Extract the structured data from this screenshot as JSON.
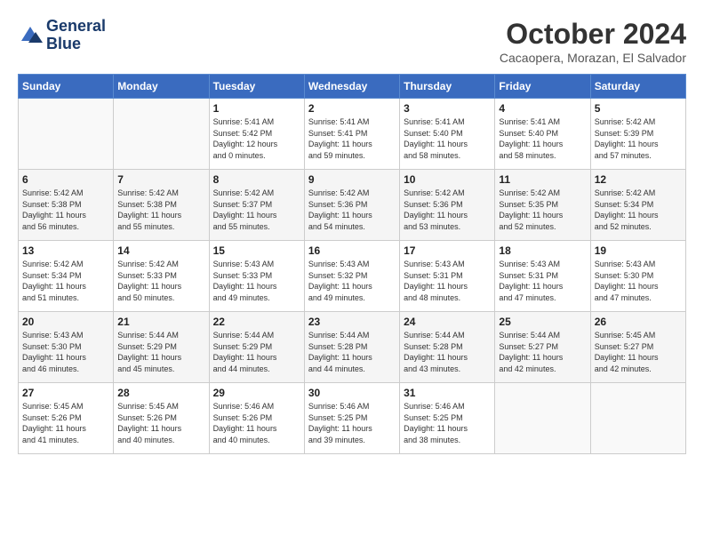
{
  "logo": {
    "text_line1": "General",
    "text_line2": "Blue"
  },
  "title": "October 2024",
  "location": "Cacaopera, Morazan, El Salvador",
  "days_of_week": [
    "Sunday",
    "Monday",
    "Tuesday",
    "Wednesday",
    "Thursday",
    "Friday",
    "Saturday"
  ],
  "weeks": [
    [
      {
        "day": "",
        "info": ""
      },
      {
        "day": "",
        "info": ""
      },
      {
        "day": "1",
        "info": "Sunrise: 5:41 AM\nSunset: 5:42 PM\nDaylight: 12 hours\nand 0 minutes."
      },
      {
        "day": "2",
        "info": "Sunrise: 5:41 AM\nSunset: 5:41 PM\nDaylight: 11 hours\nand 59 minutes."
      },
      {
        "day": "3",
        "info": "Sunrise: 5:41 AM\nSunset: 5:40 PM\nDaylight: 11 hours\nand 58 minutes."
      },
      {
        "day": "4",
        "info": "Sunrise: 5:41 AM\nSunset: 5:40 PM\nDaylight: 11 hours\nand 58 minutes."
      },
      {
        "day": "5",
        "info": "Sunrise: 5:42 AM\nSunset: 5:39 PM\nDaylight: 11 hours\nand 57 minutes."
      }
    ],
    [
      {
        "day": "6",
        "info": "Sunrise: 5:42 AM\nSunset: 5:38 PM\nDaylight: 11 hours\nand 56 minutes."
      },
      {
        "day": "7",
        "info": "Sunrise: 5:42 AM\nSunset: 5:38 PM\nDaylight: 11 hours\nand 55 minutes."
      },
      {
        "day": "8",
        "info": "Sunrise: 5:42 AM\nSunset: 5:37 PM\nDaylight: 11 hours\nand 55 minutes."
      },
      {
        "day": "9",
        "info": "Sunrise: 5:42 AM\nSunset: 5:36 PM\nDaylight: 11 hours\nand 54 minutes."
      },
      {
        "day": "10",
        "info": "Sunrise: 5:42 AM\nSunset: 5:36 PM\nDaylight: 11 hours\nand 53 minutes."
      },
      {
        "day": "11",
        "info": "Sunrise: 5:42 AM\nSunset: 5:35 PM\nDaylight: 11 hours\nand 52 minutes."
      },
      {
        "day": "12",
        "info": "Sunrise: 5:42 AM\nSunset: 5:34 PM\nDaylight: 11 hours\nand 52 minutes."
      }
    ],
    [
      {
        "day": "13",
        "info": "Sunrise: 5:42 AM\nSunset: 5:34 PM\nDaylight: 11 hours\nand 51 minutes."
      },
      {
        "day": "14",
        "info": "Sunrise: 5:42 AM\nSunset: 5:33 PM\nDaylight: 11 hours\nand 50 minutes."
      },
      {
        "day": "15",
        "info": "Sunrise: 5:43 AM\nSunset: 5:33 PM\nDaylight: 11 hours\nand 49 minutes."
      },
      {
        "day": "16",
        "info": "Sunrise: 5:43 AM\nSunset: 5:32 PM\nDaylight: 11 hours\nand 49 minutes."
      },
      {
        "day": "17",
        "info": "Sunrise: 5:43 AM\nSunset: 5:31 PM\nDaylight: 11 hours\nand 48 minutes."
      },
      {
        "day": "18",
        "info": "Sunrise: 5:43 AM\nSunset: 5:31 PM\nDaylight: 11 hours\nand 47 minutes."
      },
      {
        "day": "19",
        "info": "Sunrise: 5:43 AM\nSunset: 5:30 PM\nDaylight: 11 hours\nand 47 minutes."
      }
    ],
    [
      {
        "day": "20",
        "info": "Sunrise: 5:43 AM\nSunset: 5:30 PM\nDaylight: 11 hours\nand 46 minutes."
      },
      {
        "day": "21",
        "info": "Sunrise: 5:44 AM\nSunset: 5:29 PM\nDaylight: 11 hours\nand 45 minutes."
      },
      {
        "day": "22",
        "info": "Sunrise: 5:44 AM\nSunset: 5:29 PM\nDaylight: 11 hours\nand 44 minutes."
      },
      {
        "day": "23",
        "info": "Sunrise: 5:44 AM\nSunset: 5:28 PM\nDaylight: 11 hours\nand 44 minutes."
      },
      {
        "day": "24",
        "info": "Sunrise: 5:44 AM\nSunset: 5:28 PM\nDaylight: 11 hours\nand 43 minutes."
      },
      {
        "day": "25",
        "info": "Sunrise: 5:44 AM\nSunset: 5:27 PM\nDaylight: 11 hours\nand 42 minutes."
      },
      {
        "day": "26",
        "info": "Sunrise: 5:45 AM\nSunset: 5:27 PM\nDaylight: 11 hours\nand 42 minutes."
      }
    ],
    [
      {
        "day": "27",
        "info": "Sunrise: 5:45 AM\nSunset: 5:26 PM\nDaylight: 11 hours\nand 41 minutes."
      },
      {
        "day": "28",
        "info": "Sunrise: 5:45 AM\nSunset: 5:26 PM\nDaylight: 11 hours\nand 40 minutes."
      },
      {
        "day": "29",
        "info": "Sunrise: 5:46 AM\nSunset: 5:26 PM\nDaylight: 11 hours\nand 40 minutes."
      },
      {
        "day": "30",
        "info": "Sunrise: 5:46 AM\nSunset: 5:25 PM\nDaylight: 11 hours\nand 39 minutes."
      },
      {
        "day": "31",
        "info": "Sunrise: 5:46 AM\nSunset: 5:25 PM\nDaylight: 11 hours\nand 38 minutes."
      },
      {
        "day": "",
        "info": ""
      },
      {
        "day": "",
        "info": ""
      }
    ]
  ]
}
